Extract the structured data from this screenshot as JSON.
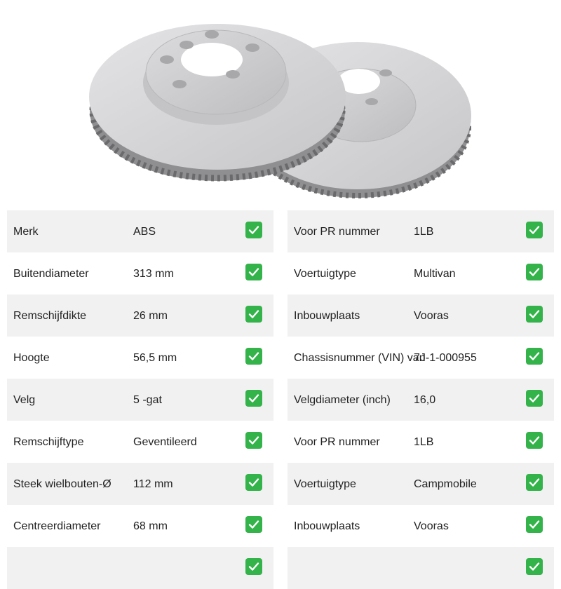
{
  "image": {
    "alt": "Remschijven",
    "disc_color": "#d2d2d4"
  },
  "check_icon": {
    "name": "check-mark-icon",
    "color": "#33b34a"
  },
  "left_specs": [
    {
      "label": "Merk",
      "value": "ABS"
    },
    {
      "label": "Buitendiameter",
      "value": "313 mm"
    },
    {
      "label": "Remschijfdikte",
      "value": "26 mm"
    },
    {
      "label": "Hoogte",
      "value": "56,5 mm"
    },
    {
      "label": "Velg",
      "value": "5 -gat"
    },
    {
      "label": "Remschijftype",
      "value": "Geventileerd"
    },
    {
      "label": "Steek wielbouten-Ø",
      "value": "112 mm"
    },
    {
      "label": "Centreerdiameter",
      "value": "68 mm"
    }
  ],
  "right_specs": [
    {
      "label": "Voor PR nummer",
      "value": "1LB"
    },
    {
      "label": "Voertuigtype",
      "value": "Multivan"
    },
    {
      "label": "Inbouwplaats",
      "value": "Vooras"
    },
    {
      "label": "Chassisnummer (VIN) van",
      "value": "7J-1-000955"
    },
    {
      "label": "Velgdiameter (inch)",
      "value": "16,0"
    },
    {
      "label": "Voor PR nummer",
      "value": "1LB"
    },
    {
      "label": "Voertuigtype",
      "value": "Campmobile"
    },
    {
      "label": "Inbouwplaats",
      "value": "Vooras"
    }
  ]
}
